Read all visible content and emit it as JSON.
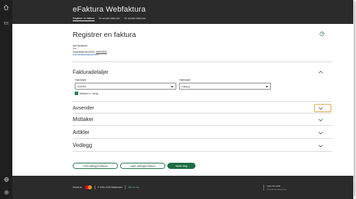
{
  "app": {
    "title": "eFaktura Webfaktura"
  },
  "nav": {
    "items": [
      "Registrer en faktura",
      "Se sendte fakturaer",
      "Se avviste fakturaer"
    ]
  },
  "page": {
    "title": "Registrer en faktura"
  },
  "user": {
    "name": "Kari Nordmann",
    "role": "Eier",
    "org_label": "Organisasjonsnummer:",
    "org_number": "999999999",
    "email": "Kari.Nordmann@bedrift.no"
  },
  "details": {
    "title": "Fakturadetaljer",
    "type_label": "Fakturatype",
    "type_value": "EHF/PE",
    "kind_label": "Fakturatype",
    "kind_value": "Faktura",
    "checkbox_label": "Mottaker er i Norge",
    "checkbox_checked": true
  },
  "sections": {
    "sender": "Avsender",
    "recipient": "Mottaker",
    "articles": "Artikler",
    "attachments": "Vedlegg"
  },
  "buttons": {
    "load": "Hent påbegynt faktura",
    "save": "Lagre påbegynt faktura",
    "next": "Neste steg"
  },
  "footer": {
    "drift_by": "Drevet av",
    "copyright": "© 1994–2024 Mastercard",
    "link": "Mer fra oss",
    "help_title": "Hjelp ditt språk",
    "help_sub": "Kontakt kundeservice"
  },
  "colors": {
    "accent": "#1e6e45",
    "header_bg": "#2b2b2b",
    "focus": "#e6a447"
  },
  "icons": [
    "home-icon",
    "grid-icon",
    "globe-icon",
    "settings-icon",
    "help-icon",
    "chevron-up-icon",
    "chevron-down-icon"
  ]
}
